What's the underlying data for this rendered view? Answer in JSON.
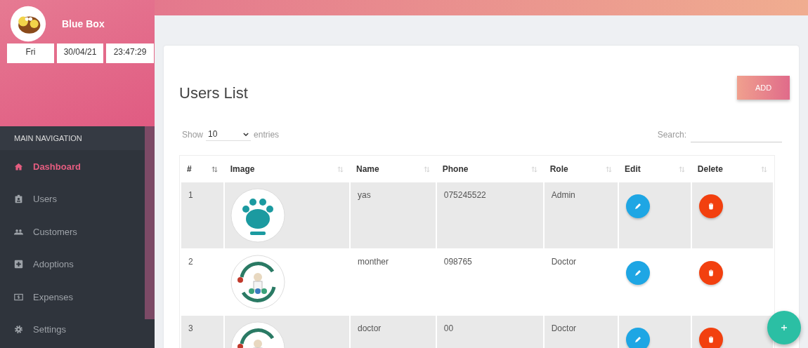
{
  "brand": {
    "name": "Blue Box",
    "day": "Fri",
    "date": "30/04/21",
    "time": "23:47:29"
  },
  "sidebar": {
    "header": "MAIN NAVIGATION",
    "items": [
      {
        "label": "Dashboard",
        "kind": "home",
        "selected": true
      },
      {
        "label": "Users",
        "kind": "badge",
        "selected": false
      },
      {
        "label": "Customers",
        "kind": "people",
        "selected": false
      },
      {
        "label": "Adoptions",
        "kind": "plus",
        "selected": false
      },
      {
        "label": "Expenses",
        "kind": "money",
        "selected": false
      },
      {
        "label": "Settings",
        "kind": "gear",
        "selected": false
      }
    ]
  },
  "page": {
    "title": "Users List",
    "add_button": "ADD"
  },
  "table_controls": {
    "show": "Show",
    "page_size": "10",
    "entries": "entries",
    "search_label": "Search:"
  },
  "table": {
    "columns": [
      "#",
      "Image",
      "Name",
      "Phone",
      "Role",
      "Edit",
      "Delete"
    ],
    "rows": [
      {
        "index": "1",
        "kind": "paw",
        "name": "yas",
        "phone": "075245522",
        "role": "Admin"
      },
      {
        "index": "2",
        "kind": "cycle",
        "name": "monther",
        "phone": "098765",
        "role": "Doctor"
      },
      {
        "index": "3",
        "kind": "cycle",
        "name": "doctor",
        "phone": "00",
        "role": "Doctor"
      }
    ]
  }
}
